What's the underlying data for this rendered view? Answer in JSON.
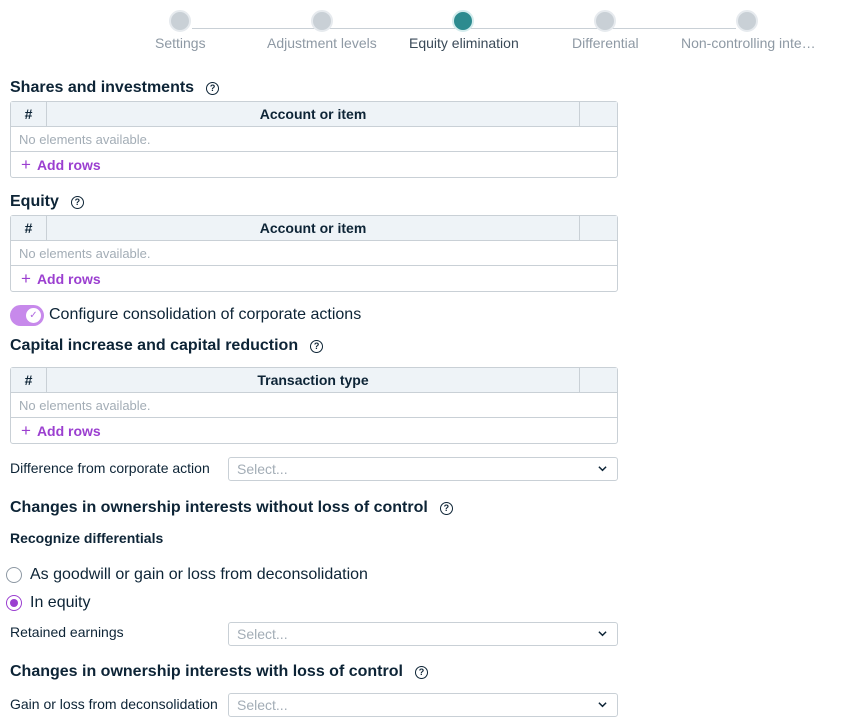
{
  "stepper": {
    "steps": [
      {
        "label": "Settings",
        "active": false
      },
      {
        "label": "Adjustment levels",
        "active": false
      },
      {
        "label": "Equity elimination",
        "active": true
      },
      {
        "label": "Differential",
        "active": false
      },
      {
        "label": "Non-controlling inte…",
        "active": false
      }
    ]
  },
  "shares": {
    "title": "Shares and investments",
    "col_num": "#",
    "col_main": "Account or item",
    "empty": "No elements available.",
    "add": "Add rows"
  },
  "equity": {
    "title": "Equity",
    "col_num": "#",
    "col_main": "Account or item",
    "empty": "No elements available.",
    "add": "Add rows"
  },
  "corporate_toggle": {
    "label": "Configure consolidation of corporate actions",
    "checked": true
  },
  "capital": {
    "title": "Capital increase and capital reduction",
    "col_num": "#",
    "col_main": "Transaction type",
    "empty": "No elements available.",
    "add": "Add rows"
  },
  "difference_field": {
    "label": "Difference from corporate action",
    "placeholder": "Select..."
  },
  "without_loss": {
    "title": "Changes in ownership interests without loss of control",
    "recognize_label": "Recognize differentials",
    "options": [
      {
        "label": "As goodwill or gain or loss from deconsolidation",
        "checked": false
      },
      {
        "label": "In equity",
        "checked": true
      }
    ],
    "retained_label": "Retained earnings",
    "retained_placeholder": "Select..."
  },
  "with_loss": {
    "title": "Changes in ownership interests with loss of control",
    "gain_label": "Gain or loss from deconsolidation",
    "gain_placeholder": "Select..."
  },
  "icons": {
    "help": "?",
    "plus": "+",
    "check": "✓"
  },
  "colors": {
    "accent": "#9b3fd0",
    "active_step": "#2d8b8f",
    "toggle_on": "#c789eb"
  }
}
